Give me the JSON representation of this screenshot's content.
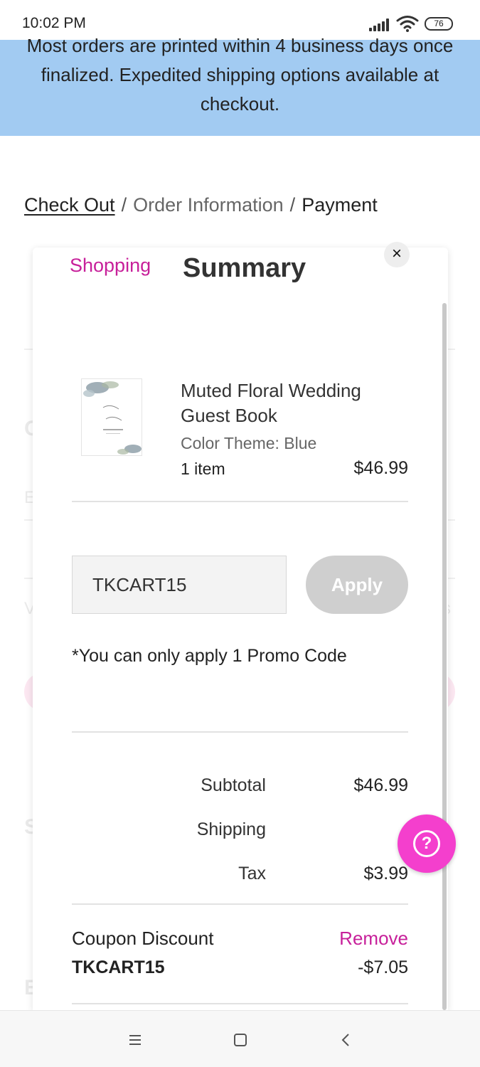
{
  "status_bar": {
    "time": "10:02 PM",
    "battery": "76",
    "icons": [
      "signal-icon",
      "wifi-icon",
      "battery-icon"
    ]
  },
  "banner": {
    "text": "Most orders are printed within 4 business days once finalized. Expedited shipping options available at checkout."
  },
  "breadcrumb": {
    "step1": "Check Out",
    "sep": "/",
    "step2": "Order Information",
    "step3": "Payment"
  },
  "summary": {
    "heading_pre": "Shopping",
    "heading": "Summary",
    "close": "×",
    "product": {
      "name": "Muted Floral Wedding Guest Book",
      "variant": "Color Theme: Blue",
      "quantity": "1 item",
      "price": "$46.99"
    },
    "promo": {
      "value": "TKCART15",
      "apply_label": "Apply",
      "note": "*You can only apply 1 Promo Code"
    },
    "totals": {
      "subtotal_label": "Subtotal",
      "subtotal_value": "$46.99",
      "shipping_label": "Shipping",
      "shipping_value": "-",
      "tax_label": "Tax",
      "tax_value": "$3.99"
    },
    "coupon": {
      "label": "Coupon Discount",
      "code": "TKCART15",
      "remove_label": "Remove",
      "amount": "-$7.05"
    }
  },
  "help": {
    "icon": "help-icon",
    "symbol": "?"
  },
  "nav_bar": {
    "icons": [
      "menu-icon",
      "home-icon",
      "back-icon"
    ]
  },
  "colors": {
    "banner": "#a2cbf2",
    "accent": "#c7209a",
    "fab": "#f43fcd",
    "apply_disabled": "#cfcfcf"
  }
}
